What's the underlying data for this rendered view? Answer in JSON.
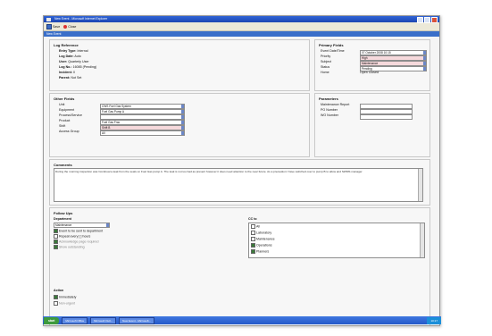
{
  "window": {
    "title": "New Event - Microsoft Internet Explorer"
  },
  "toolbar": {
    "save": "Save",
    "close": "Close"
  },
  "header": {
    "title": "New Event"
  },
  "log_reference": {
    "heading": "Log Reference",
    "rows": [
      {
        "label": "Entry Type:",
        "value": "Internal"
      },
      {
        "label": "Log Date:",
        "value": "Auto"
      },
      {
        "label": "User:",
        "value": "Quarterly User"
      },
      {
        "label": "Log No.:",
        "value": "16085 (Pending)"
      },
      {
        "label": "Incident:",
        "value": "0"
      },
      {
        "label": "Parent:",
        "value": "Not Set"
      }
    ]
  },
  "primary_fields": {
    "heading": "Primary Fields",
    "rows": [
      {
        "label": "Event Date/Time",
        "value": "07 October 2008 10:15"
      },
      {
        "label": "Priority",
        "value": "High"
      },
      {
        "label": "Subject",
        "value": "Maintenance"
      },
      {
        "label": "Status",
        "value": "Pending"
      },
      {
        "label": "Home",
        "value": "Open  Closed"
      }
    ]
  },
  "other_fields": {
    "heading": "Other Fields",
    "rows": [
      {
        "label": "Unit",
        "value": "CWS Fuel Gas System"
      },
      {
        "label": "Equipment",
        "value": "Fuel Gas Pump A"
      },
      {
        "label": "Process/Service",
        "value": ""
      },
      {
        "label": "Product",
        "value": "Fuel Gas Frac"
      },
      {
        "label": "Shift",
        "value": "Shift B"
      },
      {
        "label": "Access Group",
        "value": "All"
      }
    ]
  },
  "parameters": {
    "heading": "Parameters",
    "rows": [
      {
        "label": "Maintenance Report",
        "value": ""
      },
      {
        "label": "PO Number",
        "value": ""
      },
      {
        "label": "WO Number",
        "value": ""
      }
    ]
  },
  "comments": {
    "heading": "Comments",
    "text": "During the morning inspection was Continual a leak from the seals on Fuel Gas pump A. The leak is not too bad as present however it does need attention to the near future. As a precaution I have switched over to pump B to allow and SWMS manager."
  },
  "follow_ups": {
    "heading": "Follow Ups",
    "department_label": "Department",
    "department_value": "Maintenance",
    "checks": [
      {
        "label": "Event to be sent to department",
        "on": true
      },
      {
        "label": "Repeat every  [  ]  hours",
        "on": false
      },
      {
        "label": "Acknowledge page required",
        "on": false
      },
      {
        "label": "Show outstanding",
        "on": false
      }
    ],
    "cc_label": "CC to",
    "cc_items": [
      {
        "label": "All",
        "on": false
      },
      {
        "label": "Laboratory",
        "on": false
      },
      {
        "label": "Maintenance",
        "on": false
      },
      {
        "label": "Operations",
        "on": true
      },
      {
        "label": "Planners",
        "on": true
      }
    ],
    "action_label": "Action",
    "action_checks": [
      {
        "label": "Immediately",
        "on": true
      },
      {
        "label": "Non-urgent",
        "on": false
      }
    ]
  },
  "taskbar": {
    "start": "start",
    "items": [
      "Microsoft Office",
      "Microsoft Outl...",
      "New Event - Microsoft..."
    ],
    "clock": "10:17"
  }
}
